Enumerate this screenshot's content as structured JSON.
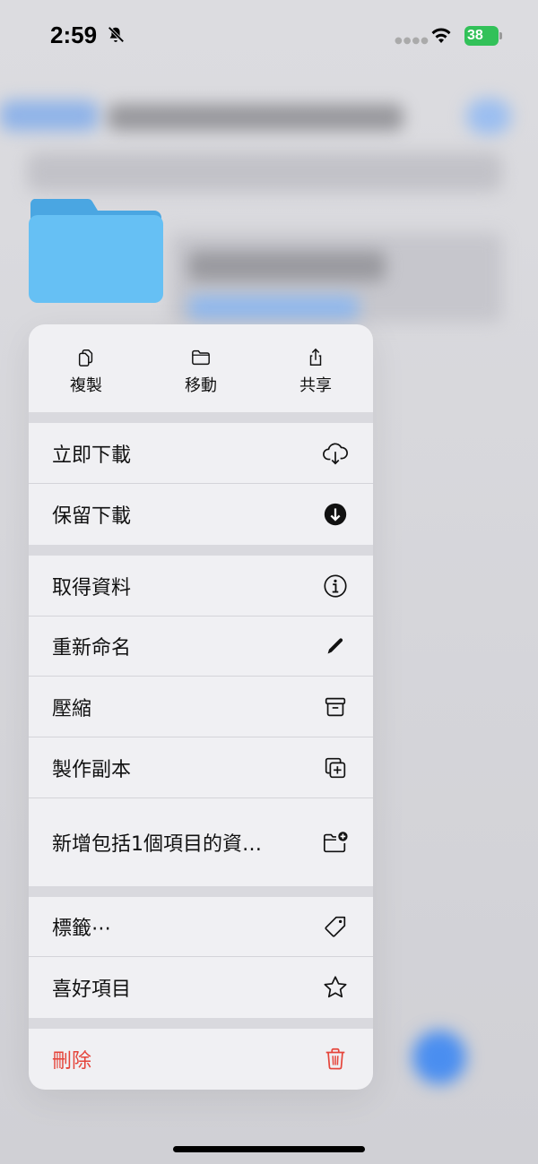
{
  "status_bar": {
    "time": "2:59",
    "battery": "38"
  },
  "menu": {
    "top_actions": [
      {
        "label": "複製",
        "icon": "copy-icon"
      },
      {
        "label": "移動",
        "icon": "folder-icon"
      },
      {
        "label": "共享",
        "icon": "share-icon"
      }
    ],
    "items": [
      {
        "label": "立即下載",
        "icon": "cloud-download-icon"
      },
      {
        "label": "保留下載",
        "icon": "download-circle-icon"
      },
      {
        "label": "取得資料",
        "icon": "info-icon"
      },
      {
        "label": "重新命名",
        "icon": "pencil-icon"
      },
      {
        "label": "壓縮",
        "icon": "archive-box-icon"
      },
      {
        "label": "製作副本",
        "icon": "duplicate-icon"
      },
      {
        "label": "新增包括1個項目的資…",
        "icon": "new-folder-icon"
      },
      {
        "label": "標籤⋯",
        "icon": "tag-icon"
      },
      {
        "label": "喜好項目",
        "icon": "star-icon"
      },
      {
        "label": "刪除",
        "icon": "trash-icon",
        "destructive": true
      }
    ]
  },
  "colors": {
    "destructive": "#e5443a",
    "folder": "#5cb9ef",
    "battery": "#32c159"
  }
}
